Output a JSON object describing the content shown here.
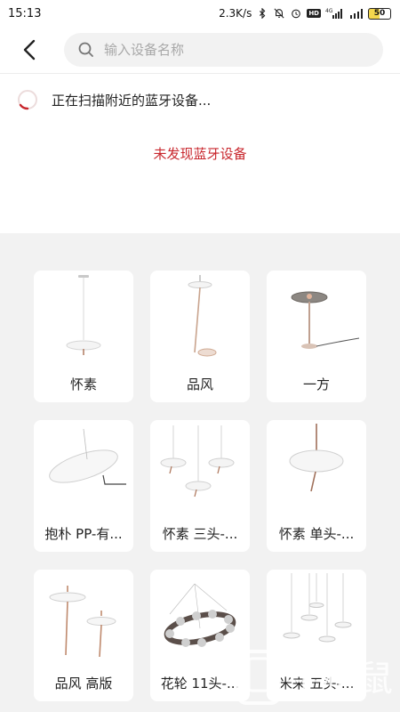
{
  "status_bar": {
    "time": "15:13",
    "net_speed": "2.3K/s",
    "network_type": "4G",
    "battery": "50"
  },
  "header": {
    "search_placeholder": "输入设备名称"
  },
  "scan": {
    "status_text": "正在扫描附近的蓝牙设备...",
    "empty_text": "未发现蓝牙设备"
  },
  "products": [
    {
      "name": "怀素",
      "icon": "pendant-lamp-icon"
    },
    {
      "name": "品风",
      "icon": "floor-lamp-icon"
    },
    {
      "name": "一方",
      "icon": "table-lamp-icon"
    },
    {
      "name": "抱朴 PP-有...",
      "icon": "disc-lamp-icon"
    },
    {
      "name": "怀素 三头-...",
      "icon": "triple-pendant-icon"
    },
    {
      "name": "怀素 单头-...",
      "icon": "single-pendant-icon"
    },
    {
      "name": "品风 高版",
      "icon": "tall-floor-lamp-icon"
    },
    {
      "name": "花轮 11头-...",
      "icon": "ring-chandelier-icon"
    },
    {
      "name": "米来 五头-...",
      "icon": "five-pendant-icon"
    }
  ],
  "watermark": {
    "text": "手机鼠"
  },
  "colors": {
    "accent_red": "#c8262c",
    "background_grey": "#f2f2f2"
  }
}
